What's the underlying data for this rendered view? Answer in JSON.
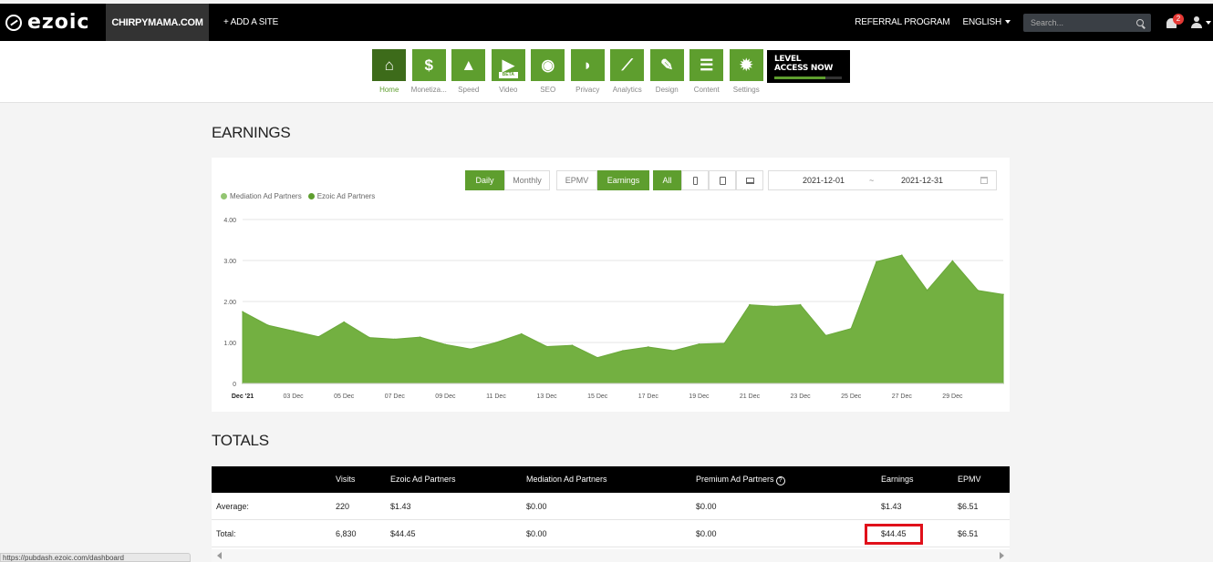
{
  "topbar": {
    "logo": "ezoic",
    "site": "CHIRPYMAMA.COM",
    "add_site": "+ ADD A SITE",
    "referral": "REFERRAL PROGRAM",
    "language": "ENGLISH",
    "search_placeholder": "Search...",
    "notifications": "2"
  },
  "nav": {
    "items": [
      {
        "label": "Home",
        "glyph": "⌂",
        "icon": "home-icon"
      },
      {
        "label": "Monetiza...",
        "glyph": "$",
        "icon": "dollar-icon"
      },
      {
        "label": "Speed",
        "glyph": "▲",
        "icon": "rocket-icon"
      },
      {
        "label": "Video",
        "glyph": "▶",
        "icon": "video-icon",
        "badge": "BETA"
      },
      {
        "label": "SEO",
        "glyph": "◉",
        "icon": "magnifier-icon"
      },
      {
        "label": "Privacy",
        "glyph": "◗",
        "icon": "shield-icon"
      },
      {
        "label": "Analytics",
        "glyph": "⟋",
        "icon": "chart-line-icon"
      },
      {
        "label": "Design",
        "glyph": "✎",
        "icon": "pencil-icon"
      },
      {
        "label": "Content",
        "glyph": "☰",
        "icon": "document-icon"
      },
      {
        "label": "Settings",
        "glyph": "✹",
        "icon": "gear-icon"
      }
    ],
    "level_line1": "LEVEL",
    "level_line2": "ACCESS NOW",
    "level_progress": 0.75
  },
  "earnings": {
    "title": "EARNINGS",
    "period_buttons": [
      "Daily",
      "Monthly"
    ],
    "metric_buttons": [
      "EPMV",
      "Earnings"
    ],
    "device_buttons": [
      "All"
    ],
    "date_from": "2021-12-01",
    "date_sep": "~",
    "date_to": "2021-12-31"
  },
  "chart_data": {
    "type": "area",
    "legend": [
      "Mediation Ad Partners",
      "Ezoic Ad Partners"
    ],
    "legend_colors": [
      "#93c572",
      "#5e9e2e"
    ],
    "yticks": [
      "4.00",
      "3.00",
      "2.00",
      "1.00",
      "0"
    ],
    "ylim": [
      0,
      4
    ],
    "xticks": [
      "Dec '21",
      "03 Dec",
      "05 Dec",
      "07 Dec",
      "09 Dec",
      "11 Dec",
      "13 Dec",
      "15 Dec",
      "17 Dec",
      "19 Dec",
      "21 Dec",
      "23 Dec",
      "25 Dec",
      "27 Dec",
      "29 Dec"
    ],
    "x": [
      "2021-12-01",
      "2021-12-02",
      "2021-12-03",
      "2021-12-04",
      "2021-12-05",
      "2021-12-06",
      "2021-12-07",
      "2021-12-08",
      "2021-12-09",
      "2021-12-10",
      "2021-12-11",
      "2021-12-12",
      "2021-12-13",
      "2021-12-14",
      "2021-12-15",
      "2021-12-16",
      "2021-12-17",
      "2021-12-18",
      "2021-12-19",
      "2021-12-20",
      "2021-12-21",
      "2021-12-22",
      "2021-12-23",
      "2021-12-24",
      "2021-12-25",
      "2021-12-26",
      "2021-12-27",
      "2021-12-28",
      "2021-12-29",
      "2021-12-30",
      "2021-12-31"
    ],
    "series": [
      {
        "name": "Ezoic Ad Partners",
        "values": [
          1.75,
          1.42,
          1.28,
          1.14,
          1.5,
          1.12,
          1.08,
          1.13,
          0.95,
          0.84,
          1.0,
          1.21,
          0.9,
          0.93,
          0.63,
          0.8,
          0.89,
          0.8,
          0.96,
          0.98,
          1.92,
          1.88,
          1.92,
          1.17,
          1.34,
          2.97,
          3.13,
          2.27,
          2.99,
          2.27,
          2.17
        ]
      },
      {
        "name": "Mediation Ad Partners",
        "values": [
          0,
          0,
          0,
          0,
          0,
          0,
          0,
          0,
          0,
          0,
          0,
          0,
          0,
          0,
          0,
          0,
          0,
          0,
          0,
          0,
          0,
          0,
          0,
          0,
          0,
          0,
          0,
          0,
          0,
          0,
          0
        ]
      }
    ],
    "area_color": "#73b041"
  },
  "totals": {
    "title": "TOTALS",
    "headers": [
      "",
      "Visits",
      "Ezoic Ad Partners",
      "Mediation Ad Partners",
      "Premium Ad Partners",
      "Earnings",
      "EPMV"
    ],
    "rows": [
      [
        "Average:",
        "220",
        "$1.43",
        "$0.00",
        "$0.00",
        "$1.43",
        "$6.51"
      ],
      [
        "Total:",
        "6,830",
        "$44.45",
        "$0.00",
        "$0.00",
        "$44.45",
        "$6.51"
      ]
    ]
  },
  "status_url": "https://pubdash.ezoic.com/dashboard"
}
